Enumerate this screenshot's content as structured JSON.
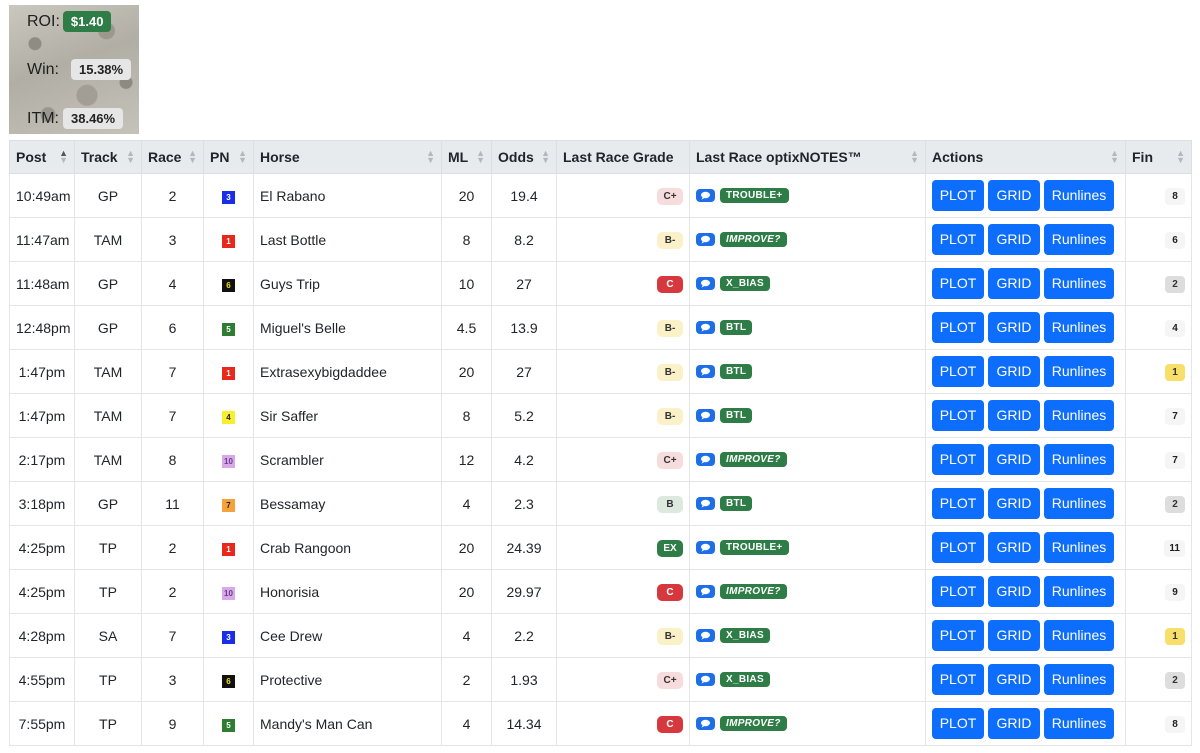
{
  "stats": {
    "roi_label": "ROI:",
    "roi_value": "$1.40",
    "win_label": "Win:",
    "win_value": "15.38%",
    "itm_label": "ITM:",
    "itm_value": "38.46%"
  },
  "headers": {
    "post": "Post",
    "track": "Track",
    "race": "Race",
    "pn": "PN",
    "horse": "Horse",
    "ml": "ML",
    "odds": "Odds",
    "grade": "Last Race Grade",
    "notes": "Last Race optixNOTES™",
    "actions": "Actions",
    "fin": "Fin"
  },
  "buttons": {
    "plot": "PLOT",
    "grid": "GRID",
    "runlines": "Runlines"
  },
  "rows": [
    {
      "post": "10:49am",
      "track": "GP",
      "race": "2",
      "pn": "3",
      "horse": "El Rabano",
      "ml": "20",
      "odds": "19.4",
      "grade": "C+",
      "note": "TROUBLE+",
      "fin": "8"
    },
    {
      "post": "11:47am",
      "track": "TAM",
      "race": "3",
      "pn": "1",
      "horse": "Last Bottle",
      "ml": "8",
      "odds": "8.2",
      "grade": "B-",
      "note": "IMPROVE?",
      "fin": "6"
    },
    {
      "post": "11:48am",
      "track": "GP",
      "race": "4",
      "pn": "6",
      "horse": "Guys Trip",
      "ml": "10",
      "odds": "27",
      "grade": "C",
      "note": "X_BIAS",
      "fin": "2"
    },
    {
      "post": "12:48pm",
      "track": "GP",
      "race": "6",
      "pn": "5",
      "horse": "Miguel's Belle",
      "ml": "4.5",
      "odds": "13.9",
      "grade": "B-",
      "note": "BTL",
      "fin": "4"
    },
    {
      "post": "1:47pm",
      "track": "TAM",
      "race": "7",
      "pn": "1",
      "horse": "Extrasexybigdaddee",
      "ml": "20",
      "odds": "27",
      "grade": "B-",
      "note": "BTL",
      "fin": "1"
    },
    {
      "post": "1:47pm",
      "track": "TAM",
      "race": "7",
      "pn": "4",
      "horse": "Sir Saffer",
      "ml": "8",
      "odds": "5.2",
      "grade": "B-",
      "note": "BTL",
      "fin": "7"
    },
    {
      "post": "2:17pm",
      "track": "TAM",
      "race": "8",
      "pn": "10",
      "horse": "Scrambler",
      "ml": "12",
      "odds": "4.2",
      "grade": "C+",
      "note": "IMPROVE?",
      "fin": "7"
    },
    {
      "post": "3:18pm",
      "track": "GP",
      "race": "11",
      "pn": "7",
      "horse": "Bessamay",
      "ml": "4",
      "odds": "2.3",
      "grade": "B",
      "note": "BTL",
      "fin": "2"
    },
    {
      "post": "4:25pm",
      "track": "TP",
      "race": "2",
      "pn": "1",
      "horse": "Crab Rangoon",
      "ml": "20",
      "odds": "24.39",
      "grade": "EX",
      "note": "TROUBLE+",
      "fin": "11"
    },
    {
      "post": "4:25pm",
      "track": "TP",
      "race": "2",
      "pn": "10",
      "horse": "Honorisia",
      "ml": "20",
      "odds": "29.97",
      "grade": "C",
      "note": "IMPROVE?",
      "fin": "9"
    },
    {
      "post": "4:28pm",
      "track": "SA",
      "race": "7",
      "pn": "3",
      "horse": "Cee Drew",
      "ml": "4",
      "odds": "2.2",
      "grade": "B-",
      "note": "X_BIAS",
      "fin": "1"
    },
    {
      "post": "4:55pm",
      "track": "TP",
      "race": "3",
      "pn": "6",
      "horse": "Protective",
      "ml": "2",
      "odds": "1.93",
      "grade": "C+",
      "note": "X_BIAS",
      "fin": "2"
    },
    {
      "post": "7:55pm",
      "track": "TP",
      "race": "9",
      "pn": "5",
      "horse": "Mandy's Man Can",
      "ml": "4",
      "odds": "14.34",
      "grade": "C",
      "note": "IMPROVE?",
      "fin": "8"
    }
  ],
  "colors": {
    "pn": {
      "1": {
        "bg": "#e8281b",
        "fg": "#ffffff"
      },
      "3": {
        "bg": "#1a2ee8",
        "fg": "#ffffff"
      },
      "4": {
        "bg": "#f7ee2c",
        "fg": "#222222"
      },
      "5": {
        "bg": "#2e7d32",
        "fg": "#ffffff"
      },
      "6": {
        "bg": "#111111",
        "fg": "#f2e200"
      },
      "7": {
        "bg": "#f5a23a",
        "fg": "#222222"
      },
      "10": {
        "bg": "#d8a8e8",
        "fg": "#6a3d8a"
      }
    },
    "grade": {
      "C+": {
        "bg": "#f6dcdc",
        "fg": "#333333"
      },
      "C": {
        "bg": "#d7383e",
        "fg": "#ffffff"
      },
      "B-": {
        "bg": "#fbf1c9",
        "fg": "#333333"
      },
      "B": {
        "bg": "#dde9df",
        "fg": "#333333"
      },
      "EX": {
        "bg": "#2e7d47",
        "fg": "#ffffff"
      }
    },
    "fin": {
      "1": {
        "bg": "#f8df6a",
        "fg": "#333333"
      },
      "2": {
        "bg": "#dddddd",
        "fg": "#333333"
      },
      "default": {
        "bg": "#f5f5f5",
        "fg": "#222222"
      }
    }
  },
  "icons": {
    "note": "chat-bubble-icon",
    "sort": "sort-arrows-icon",
    "sort_active": "sort-up-icon"
  }
}
